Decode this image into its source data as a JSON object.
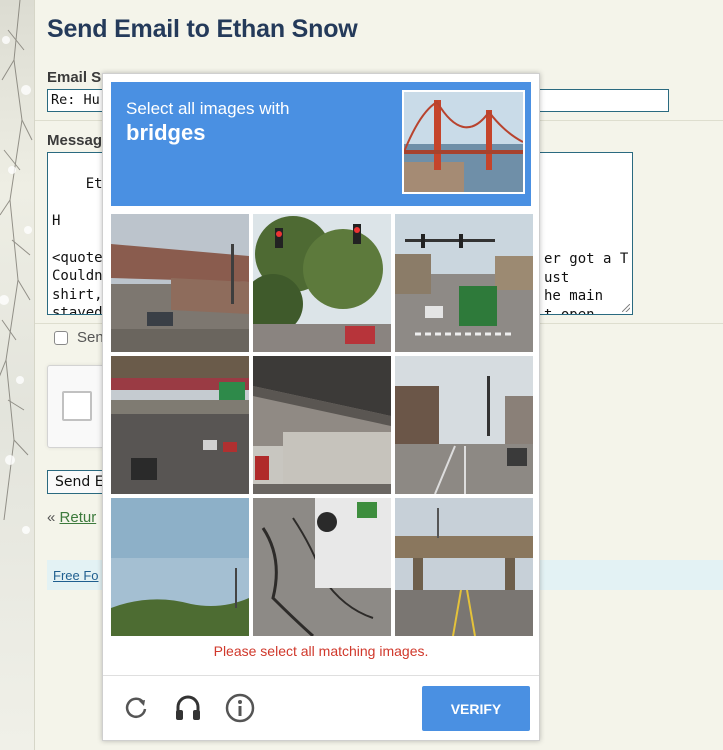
{
  "page": {
    "title": "Send Email to Ethan Snow",
    "subject_label": "Email S",
    "subject_value": "Re: Hu",
    "message_label": "Messag",
    "message_text": "Ethan,\n\nH\n\n<quote\nCouldn'\nshirt, u\nstayed\nlodge t",
    "message_tail": "er got a T\nust\nhe main\nt open",
    "save_copy_label": "Sen",
    "send_button_label": "Send E",
    "return_prefix": "«",
    "return_link": "Retur",
    "footer_link": "Free Fo"
  },
  "captcha": {
    "instruction": "Select all images with",
    "target": "bridges",
    "error": "Please select all matching images.",
    "verify_label": "VERIFY",
    "icons": [
      "reload-icon",
      "audio-icon",
      "info-icon"
    ],
    "tiles": [
      {
        "scene": "highway overpass"
      },
      {
        "scene": "traffic lights and trees"
      },
      {
        "scene": "intersection with truck"
      },
      {
        "scene": "highway under bridge with sign"
      },
      {
        "scene": "truck under overpass"
      },
      {
        "scene": "city street"
      },
      {
        "scene": "sky and trees"
      },
      {
        "scene": "asphalt with truck"
      },
      {
        "scene": "road under overpass"
      }
    ],
    "colors": {
      "accent": "#4a90e2",
      "error": "#d0382b"
    }
  }
}
